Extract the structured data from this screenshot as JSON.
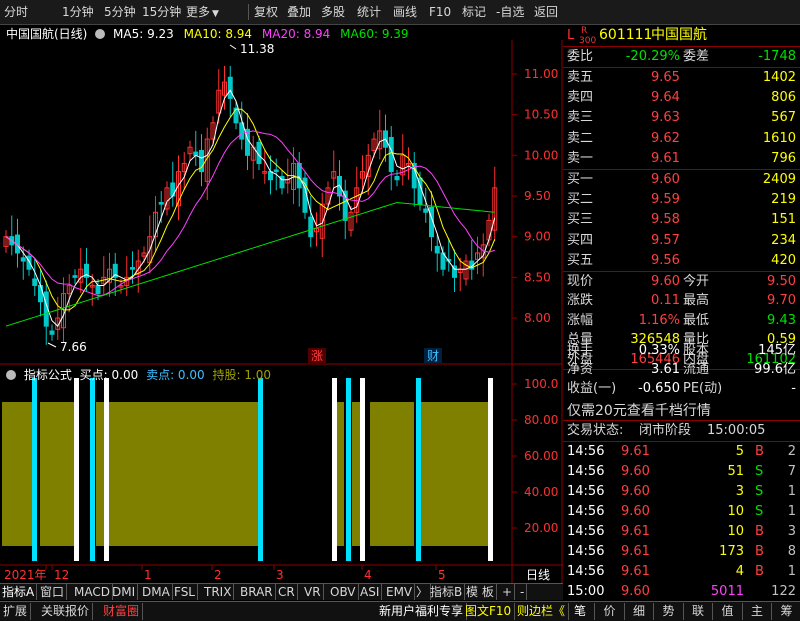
{
  "toolbar": {
    "items": [
      "分时",
      "1分钟",
      "5分钟",
      "15分钟",
      "更多",
      "复权",
      "叠加",
      "多股",
      "统计",
      "画线",
      "F10",
      "标记",
      "-自选",
      "返回"
    ],
    "more_arrow": "▼"
  },
  "chart": {
    "title": "中国国航(日线)",
    "ma5": "MA5: 9.23",
    "ma10": "MA10: 8.94",
    "ma20": "MA20: 8.94",
    "ma60": "MA60: 9.39",
    "high_label": "11.38",
    "low_label": "7.66",
    "marker_zhang": "涨",
    "marker_cai": "财",
    "price_ticks": [
      "11.00",
      "10.50",
      "10.00",
      "9.50",
      "9.00",
      "8.50",
      "8.00"
    ],
    "indicator_title": "指标公式",
    "buy_label": "买点: 0.00",
    "sell_label": "卖点: 0.00",
    "hold_label": "持股: 1.00",
    "indicator_ticks": [
      "100.0",
      "80.00",
      "60.00",
      "40.00",
      "20.00"
    ],
    "date_labels": [
      "2021年",
      "12",
      "1",
      "2",
      "3",
      "4",
      "5"
    ],
    "period_label": "日线"
  },
  "colors": {
    "up": "#ff3030",
    "down": "#00c8c8",
    "ma5": "#ffffff",
    "ma10": "#ffff00",
    "ma20": "#ff40ff",
    "ma60": "#00e000",
    "fill": "#808000",
    "cyan": "#00e0ff"
  },
  "quote": {
    "badge_l": "L",
    "badge_r": "R",
    "badge_num": "300",
    "code": "601111",
    "name": "中国国航",
    "weibi_label": "委比",
    "weibi": "-20.29%",
    "weicha_label": "委差",
    "weicha": "-1748",
    "asks": [
      {
        "label": "卖五",
        "price": "9.65",
        "vol": "1402"
      },
      {
        "label": "卖四",
        "price": "9.64",
        "vol": "806"
      },
      {
        "label": "卖三",
        "price": "9.63",
        "vol": "567"
      },
      {
        "label": "卖二",
        "price": "9.62",
        "vol": "1610"
      },
      {
        "label": "卖一",
        "price": "9.61",
        "vol": "796"
      }
    ],
    "bids": [
      {
        "label": "买一",
        "price": "9.60",
        "vol": "2409"
      },
      {
        "label": "买二",
        "price": "9.59",
        "vol": "219"
      },
      {
        "label": "买三",
        "price": "9.58",
        "vol": "151"
      },
      {
        "label": "买四",
        "price": "9.57",
        "vol": "234"
      },
      {
        "label": "买五",
        "price": "9.56",
        "vol": "420"
      }
    ],
    "stats": [
      {
        "l1": "现价",
        "v1": "9.60",
        "l2": "今开",
        "v2": "9.50",
        "c1": "red",
        "c2": "red"
      },
      {
        "l1": "涨跌",
        "v1": "0.11",
        "l2": "最高",
        "v2": "9.70",
        "c1": "red",
        "c2": "red"
      },
      {
        "l1": "涨幅",
        "v1": "1.16%",
        "l2": "最低",
        "v2": "9.43",
        "c1": "red",
        "c2": "green"
      },
      {
        "l1": "总量",
        "v1": "326548",
        "l2": "量比",
        "v2": "0.59",
        "c1": "yellow",
        "c2": "yellow"
      },
      {
        "l1": "外盘",
        "v1": "165446",
        "l2": "内盘",
        "v2": "161102",
        "c1": "red",
        "c2": "green"
      }
    ],
    "stats2": [
      {
        "l1": "换手",
        "v1": "0.33%",
        "l2": "股本",
        "v2": "145亿"
      },
      {
        "l1": "净资",
        "v1": "3.61",
        "l2": "流通",
        "v2": "99.6亿"
      },
      {
        "l1": "收益(一)",
        "v1": "-0.650",
        "l2": "PE(动)",
        "v2": "-"
      }
    ],
    "promo": "仅需20元查看千档行情",
    "status_label": "交易状态:",
    "status_value": "闭市阶段",
    "status_time": "15:00:05",
    "ticks": [
      {
        "t": "14:56",
        "p": "9.61",
        "v": "5",
        "s": "B",
        "n": "2"
      },
      {
        "t": "14:56",
        "p": "9.60",
        "v": "51",
        "s": "S",
        "n": "7"
      },
      {
        "t": "14:56",
        "p": "9.60",
        "v": "3",
        "s": "S",
        "n": "1"
      },
      {
        "t": "14:56",
        "p": "9.60",
        "v": "10",
        "s": "S",
        "n": "1"
      },
      {
        "t": "14:56",
        "p": "9.61",
        "v": "10",
        "s": "B",
        "n": "3"
      },
      {
        "t": "14:56",
        "p": "9.61",
        "v": "173",
        "s": "B",
        "n": "8"
      },
      {
        "t": "14:56",
        "p": "9.61",
        "v": "4",
        "s": "B",
        "n": "1"
      },
      {
        "t": "15:00",
        "p": "9.60",
        "v": "5011",
        "s": "",
        "n": "122"
      }
    ]
  },
  "tabs1": [
    "指标A",
    "窗口",
    "MACD",
    "DMI",
    "DMA",
    "FSL",
    "TRIX",
    "BRAR",
    "CR",
    "VR",
    "OBV",
    "ASI",
    "EMV",
    "〉",
    "指标B",
    "模 板",
    "+",
    "-"
  ],
  "tabs2": {
    "left": [
      "扩展",
      "关联报价",
      "财富圈"
    ],
    "mid": [
      "新用户福利专享",
      "图文F10",
      "则边栏《"
    ],
    "right": [
      "笔",
      "价",
      "细",
      "势",
      "联",
      "值",
      "主",
      "筹"
    ]
  }
}
